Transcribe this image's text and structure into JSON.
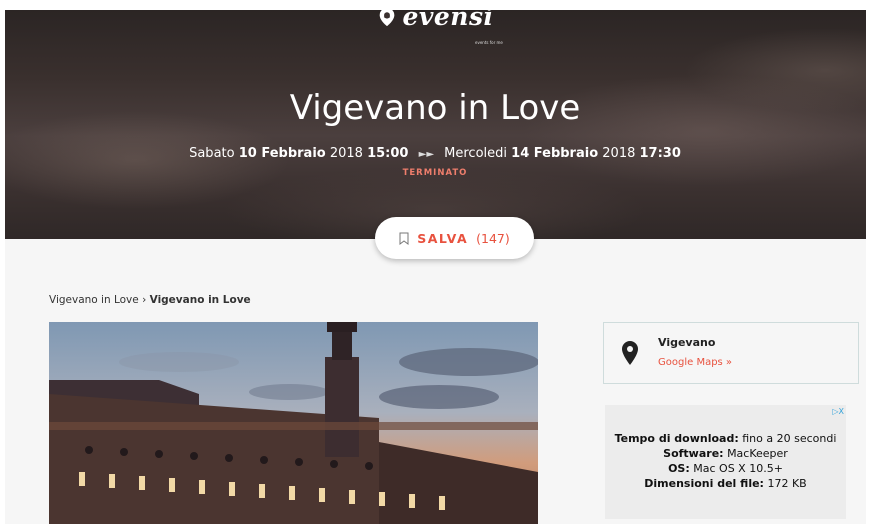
{
  "brand": {
    "name": "evensi",
    "tagline": "events for me"
  },
  "event": {
    "title": "Vigevano in Love",
    "start_day": "Sabato",
    "start_date": "10 Febbraio",
    "start_year": "2018",
    "start_time": "15:00",
    "separator": "►►",
    "end_day": "Mercoledi",
    "end_date": "14 Febbraio",
    "end_year": "2018",
    "end_time": "17:30",
    "status": "TERMINATO"
  },
  "save": {
    "label": "SALVA",
    "count": "(147)"
  },
  "breadcrumb": {
    "first": "Vigevano in Love",
    "sep": "›",
    "current": "Vigevano in Love"
  },
  "location": {
    "name": "Vigevano",
    "map_link": "Google Maps »"
  },
  "ad": {
    "badge": "▷X",
    "line1_label": "Tempo di download:",
    "line1_value": "fino a 20 secondi",
    "line2_label": "Software:",
    "line2_value": "MacKeeper",
    "line3_label": "OS:",
    "line3_value": "Mac OS X 10.5+",
    "line4_label": "Dimensioni del file:",
    "line4_value": "172 KB"
  },
  "colors": {
    "accent": "#e8523f",
    "status": "#ef7e6c",
    "hero_dark": "#2b2524"
  }
}
